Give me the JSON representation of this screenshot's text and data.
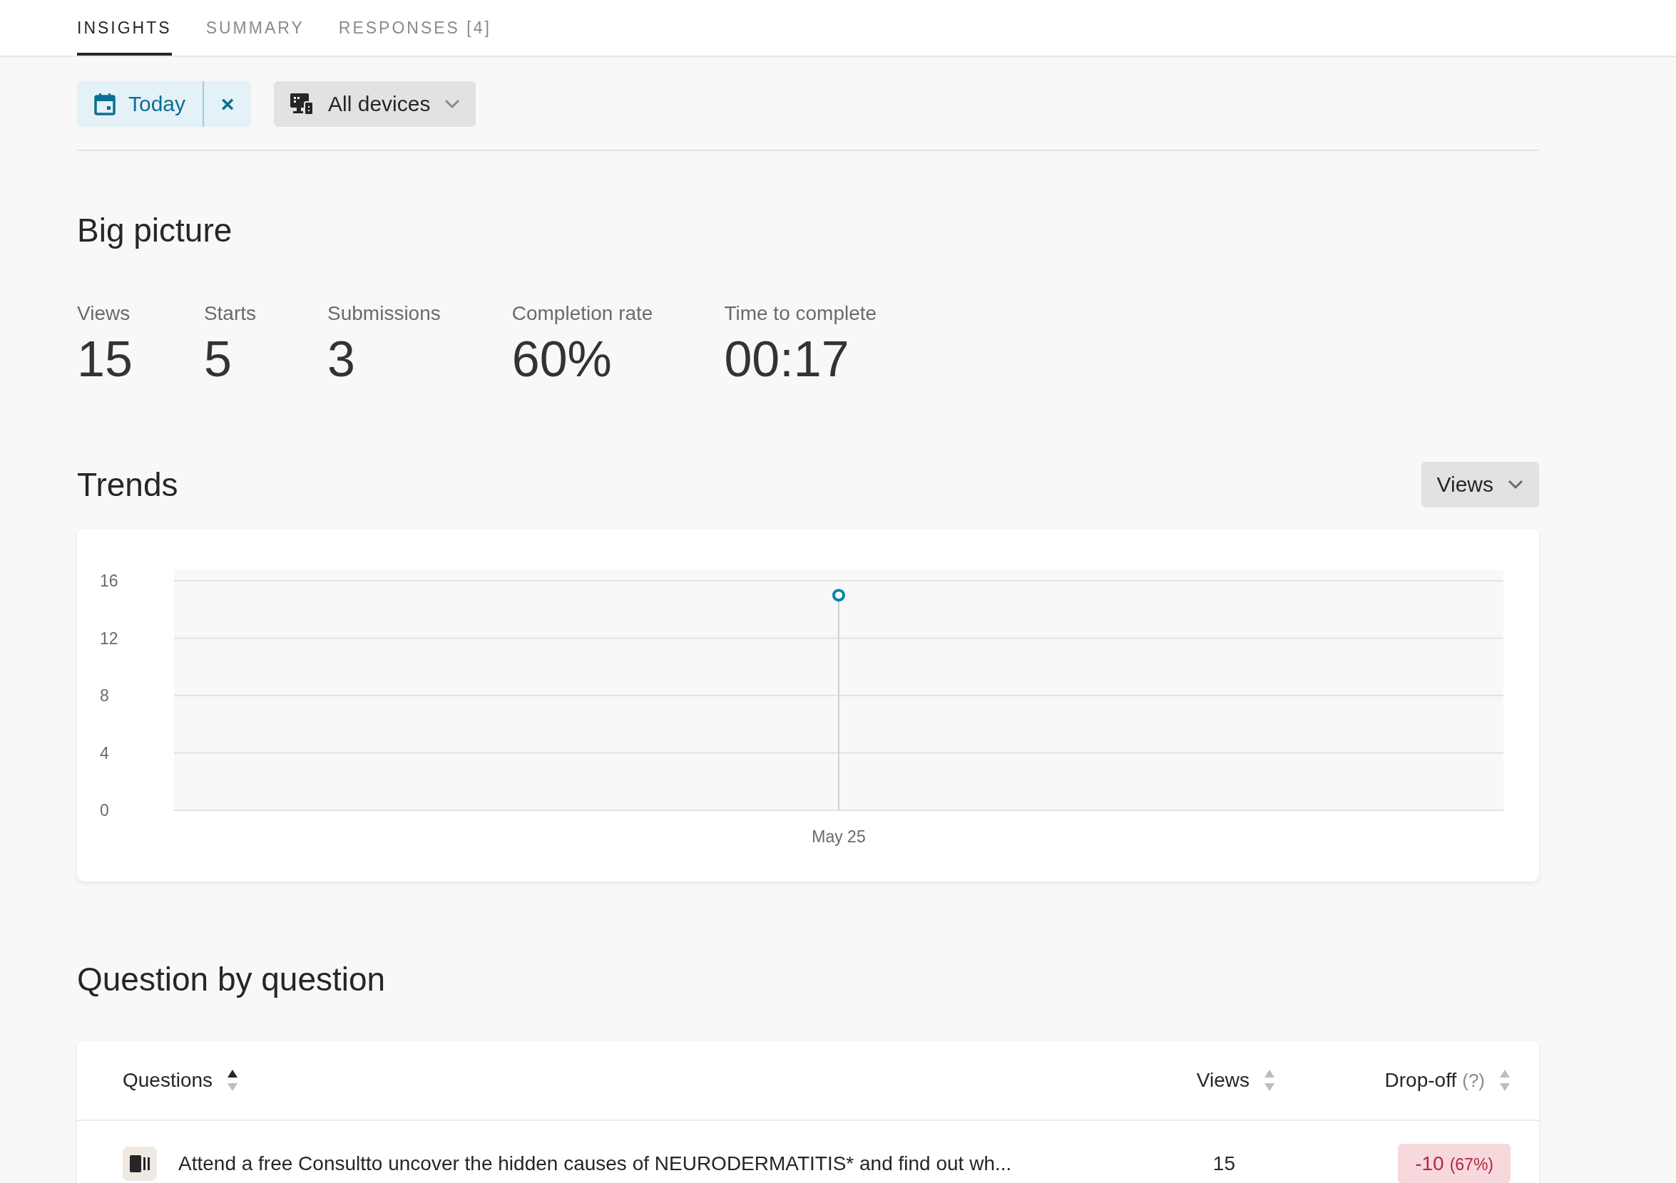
{
  "tabs": [
    {
      "label": "INSIGHTS",
      "selected": true
    },
    {
      "label": "SUMMARY",
      "selected": false
    },
    {
      "label": "RESPONSES [4]",
      "selected": false
    }
  ],
  "filters": {
    "date": {
      "label": "Today",
      "clear": "×"
    },
    "devices": {
      "label": "All devices"
    }
  },
  "big_picture": {
    "title": "Big picture",
    "stats": [
      {
        "label": "Views",
        "value": "15"
      },
      {
        "label": "Starts",
        "value": "5"
      },
      {
        "label": "Submissions",
        "value": "3"
      },
      {
        "label": "Completion rate",
        "value": "60%"
      },
      {
        "label": "Time to complete",
        "value": "00:17"
      }
    ]
  },
  "trends": {
    "title": "Trends",
    "chart_data": {
      "type": "line",
      "grid": true,
      "categories": [
        "May 25"
      ],
      "series": [
        {
          "name": "Views",
          "color": "#0b84a8",
          "marker": "o",
          "values": [
            15
          ]
        }
      ],
      "ref_lines": [
        {
          "axis": "x",
          "value": "May 25"
        }
      ],
      "ylim": [
        0,
        16
      ],
      "yticks": [
        0,
        4,
        8,
        12,
        16
      ]
    }
  },
  "questions": {
    "title": "Question by question",
    "columns": [
      {
        "label": "Questions",
        "sorted": true
      },
      {
        "label": "Views",
        "sorted": false
      },
      {
        "label": "Drop-off",
        "hint": "(?)",
        "sorted": false
      }
    ],
    "rows": [
      {
        "question": "Attend a free Consultto uncover the hidden causes of NEURODERMATITIS* and find out wh...",
        "views": "15",
        "dropoff": "-10",
        "dropoff_share": "(67%)"
      }
    ]
  }
}
